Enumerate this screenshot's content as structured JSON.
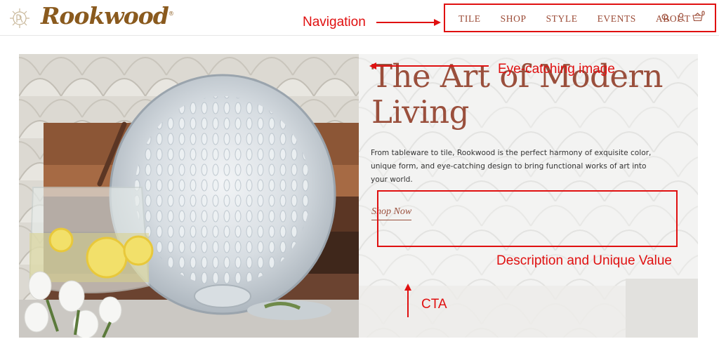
{
  "brand": {
    "name": "Rookwood",
    "trademark": "®"
  },
  "nav": {
    "items": [
      "TILE",
      "SHOP",
      "STYLE",
      "EVENTS",
      "ABOUT"
    ],
    "cart_count": "0",
    "icons": [
      "search-icon",
      "user-icon",
      "cart-icon"
    ]
  },
  "hero": {
    "title": "The Art of Modern Living",
    "description": "From tableware to tile, Rookwood is the perfect harmony of exquisite color, unique form, and eye-catching design to bring functional works of art into your world.",
    "cta": "Shop Now"
  },
  "annotations": {
    "navigation": "Navigation",
    "image": "Eye-catching image",
    "description": "Description and Unique Value",
    "cta": "CTA"
  },
  "colors": {
    "accent": "#9a4f3c",
    "logo": "#8a5a1e",
    "annotation": "#e01010"
  }
}
